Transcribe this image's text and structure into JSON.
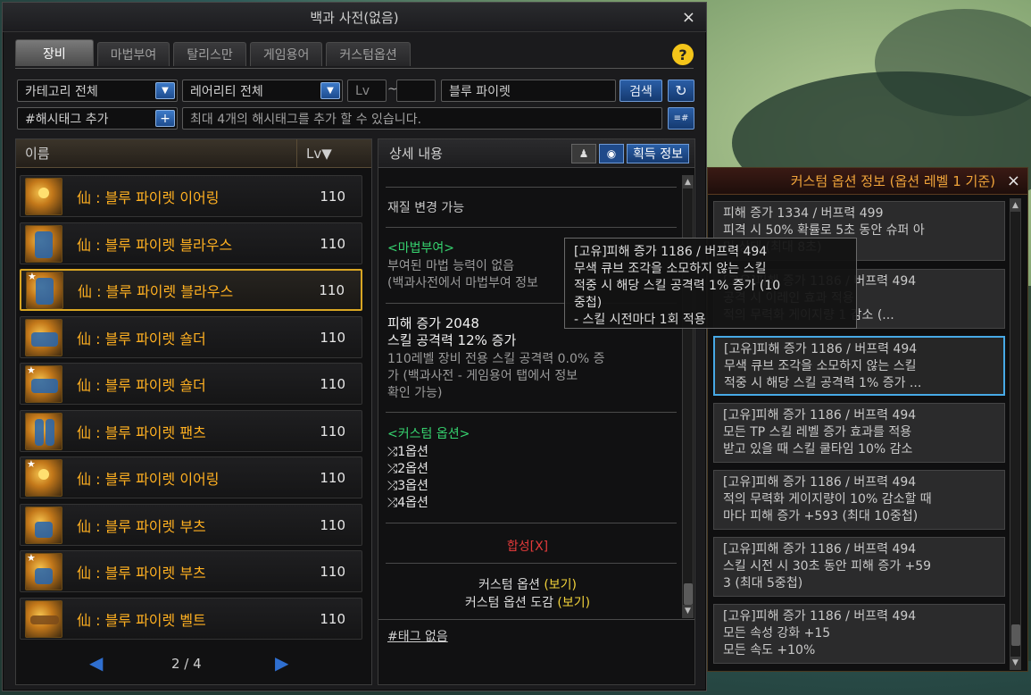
{
  "window": {
    "title": "백과 사전(없음)",
    "close_icon": "×"
  },
  "tabs": [
    {
      "label": "장비",
      "active": true
    },
    {
      "label": "마법부여"
    },
    {
      "label": "탈리스만"
    },
    {
      "label": "게임용어"
    },
    {
      "label": "커스텀옵션"
    }
  ],
  "help_icon": "?",
  "filters": {
    "category": "카테고리 전체",
    "rarity": "레어리티 전체",
    "lv_placeholder": "Lv",
    "lv_sep": "~",
    "search_value": "블루 파이렛",
    "search_button": "검색",
    "refresh_icon": "↻",
    "hashtag_label": "#해시태그 추가",
    "hashtag_add_icon": "+",
    "hashtag_placeholder": "최대 4개의 해시태그를 추가 할 수 있습니다.",
    "hashtag_menu_icon": "≡#"
  },
  "list": {
    "col_name": "이름",
    "col_lv": "Lv▼",
    "items": [
      {
        "name": "仙 : 블루 파이렛 이어링",
        "lv": "110"
      },
      {
        "name": "仙 : 블루 파이렛 블라우스",
        "lv": "110"
      },
      {
        "name": "仙 : 블루 파이렛 블라우스",
        "lv": "110",
        "selected": true
      },
      {
        "name": "仙 : 블루 파이렛 숄더",
        "lv": "110"
      },
      {
        "name": "仙 : 블루 파이렛 숄더",
        "lv": "110"
      },
      {
        "name": "仙 : 블루 파이렛 팬츠",
        "lv": "110"
      },
      {
        "name": "仙 : 블루 파이렛 이어링",
        "lv": "110"
      },
      {
        "name": "仙 : 블루 파이렛 부츠",
        "lv": "110"
      },
      {
        "name": "仙 : 블루 파이렛 부츠",
        "lv": "110"
      },
      {
        "name": "仙 : 블루 파이렛 벨트",
        "lv": "110"
      }
    ],
    "page": "2 / 4",
    "prev_icon": "◀",
    "next_icon": "▶"
  },
  "detail": {
    "title": "상세 내용",
    "acquire_button": "획득 정보",
    "material_change": "재질 변경 가능",
    "enchant_header": "<마법부여>",
    "enchant_line1": "부여된 마법 능력이 없음",
    "enchant_line2": "(백과사전에서 마법부여 정보",
    "dmg": "피해 증가 2048",
    "skill_atk": "스킬 공격력 12% 증가",
    "note1": "110레벨 장비 전용 스킬 공격력 0.0% 증",
    "note2": "가 (백과사전 - 게임용어 탭에서 정보",
    "note3": "확인 가능)",
    "custom_header": "<커스텀 옵션>",
    "options": [
      "1옵션",
      "2옵션",
      "3옵션",
      "4옵션"
    ],
    "synthesis": "합성[X]",
    "custom_view_prefix": "커스텀 옵션 ",
    "custom_view_link": "(보기)",
    "custom_book_prefix": "커스텀 옵션 도감 ",
    "custom_book_link": "(보기)",
    "tag": "#태그 없음"
  },
  "tooltip": {
    "line1": "[고유]피해 증가 1186 / 버프력 494",
    "line2": "무색 큐브 조각을 소모하지 않는 스킬",
    "line3": "적중 시 해당 스킬 공격력 1% 증가 (10",
    "line4": "중첩)",
    "line5": "- 스킬 시전마다 1회 적용"
  },
  "custom_panel": {
    "title": "커스텀 옵션 정보 (옵션 레벨 1 기준)",
    "close_icon": "×",
    "options": [
      {
        "l1": "피해 증가 1334 / 버프력 499",
        "l2": "피격 시 50% 확률로 5초 동안 슈퍼 아",
        "l3": "머 상태 (최대 8초)"
      },
      {
        "l1": "[고유]피해 증가 1186 / 버프력 494",
        "l2": "공격 시 이레인 효과 적용",
        "l3": "적의 무력화 게이지량 1 감소 (..."
      },
      {
        "l1": "[고유]피해 증가 1186 / 버프력 494",
        "l2": "무색 큐브 조각을 소모하지 않는 스킬",
        "l3": "적중 시 해당 스킬 공격력 1% 증가 ...",
        "active": true
      },
      {
        "l1": "[고유]피해 증가 1186 / 버프력 494",
        "l2": "모든 TP 스킬 레벨 증가 효과를 적용",
        "l3": "받고 있을 때 스킬 쿨타임 10% 감소"
      },
      {
        "l1": "[고유]피해 증가 1186 / 버프력 494",
        "l2": "적의 무력화 게이지량이 10% 감소할 때",
        "l3": "마다 피해 증가 +593 (최대 10중첩)"
      },
      {
        "l1": "[고유]피해 증가 1186 / 버프력 494",
        "l2": "스킬 시전 시 30초 동안 피해 증가 +59",
        "l3": "3 (최대 5중첩)"
      },
      {
        "l1": "[고유]피해 증가 1186 / 버프력 494",
        "l2": "모든 속성 강화 +15",
        "l3": "모든 속도 +10%"
      }
    ]
  },
  "colors": {
    "accent_gold": "#ffb021",
    "enchant_green": "#36d36f",
    "link_yellow": "#f2d33a",
    "synth_red": "#e23a3a",
    "active_blue": "#47a9e6"
  }
}
